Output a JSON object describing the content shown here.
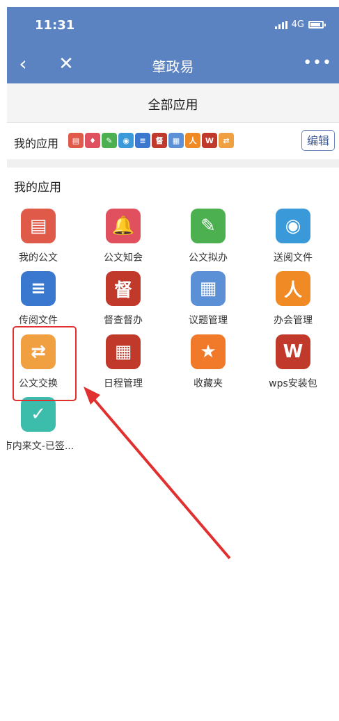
{
  "status_bar": {
    "time": "11:31",
    "network": "4G"
  },
  "nav": {
    "title": "肇政易",
    "back_icon": "chevron-left-icon",
    "close_icon": "close-icon",
    "more_icon": "more-dots-icon"
  },
  "section_header": {
    "title": "全部应用"
  },
  "my_apps_strip": {
    "label": "我的应用",
    "edit_label": "编辑",
    "mini_icons": [
      {
        "name": "documents-mini-icon",
        "glyph": "▤",
        "color": "#e05a4a"
      },
      {
        "name": "notice-mini-icon",
        "glyph": "♦",
        "color": "#e0505e"
      },
      {
        "name": "draft-mini-icon",
        "glyph": "✎",
        "color": "#4caf50"
      },
      {
        "name": "send-read-mini-icon",
        "glyph": "◉",
        "color": "#3a9ad9"
      },
      {
        "name": "circulate-mini-icon",
        "glyph": "≡",
        "color": "#3a78d0"
      },
      {
        "name": "supervise-mini-icon",
        "glyph": "督",
        "color": "#c0392b"
      },
      {
        "name": "agenda-mini-icon",
        "glyph": "▦",
        "color": "#5b8fd6"
      },
      {
        "name": "meeting-mini-icon",
        "glyph": "人",
        "color": "#f08a24"
      },
      {
        "name": "wps-mini-icon",
        "glyph": "W",
        "color": "#c0392b"
      },
      {
        "name": "exchange-mini-icon",
        "glyph": "⇄",
        "color": "#f0a040"
      }
    ]
  },
  "grid": {
    "title": "我的应用",
    "apps": [
      {
        "label": "我的公文",
        "icon": "documents-box-icon",
        "glyph": "▤",
        "color": "#e05a4a"
      },
      {
        "label": "公文知会",
        "icon": "bell-notice-icon",
        "glyph": "🔔",
        "color": "#e0505e"
      },
      {
        "label": "公文拟办",
        "icon": "document-edit-icon",
        "glyph": "✎",
        "color": "#4caf50"
      },
      {
        "label": "送阅文件",
        "icon": "document-eye-icon",
        "glyph": "◉",
        "color": "#3a9ad9"
      },
      {
        "label": "传阅文件",
        "icon": "document-forward-icon",
        "glyph": "≡",
        "color": "#3a78d0"
      },
      {
        "label": "督查督办",
        "icon": "supervise-shield-icon",
        "glyph": "督",
        "color": "#c0392b"
      },
      {
        "label": "议题管理",
        "icon": "tray-document-icon",
        "glyph": "▦",
        "color": "#5b8fd6"
      },
      {
        "label": "办会管理",
        "icon": "meeting-people-icon",
        "glyph": "人",
        "color": "#f08a24"
      },
      {
        "label": "公文交换",
        "icon": "document-exchange-icon",
        "glyph": "⇄",
        "color": "#f0a040"
      },
      {
        "label": "日程管理",
        "icon": "calendar-icon",
        "glyph": "▦",
        "color": "#c0392b"
      },
      {
        "label": "收藏夹",
        "icon": "folder-star-icon",
        "glyph": "★",
        "color": "#f07a2a"
      },
      {
        "label": "wps安装包",
        "icon": "wps-logo-icon",
        "glyph": "W",
        "color": "#c0392b"
      },
      {
        "label": "市内来文-已签...",
        "icon": "document-check-icon",
        "glyph": "✓",
        "color": "#3cbcaa"
      }
    ]
  },
  "annotation": {
    "highlight_color": "#e03030",
    "arrow_color": "#e03030"
  }
}
